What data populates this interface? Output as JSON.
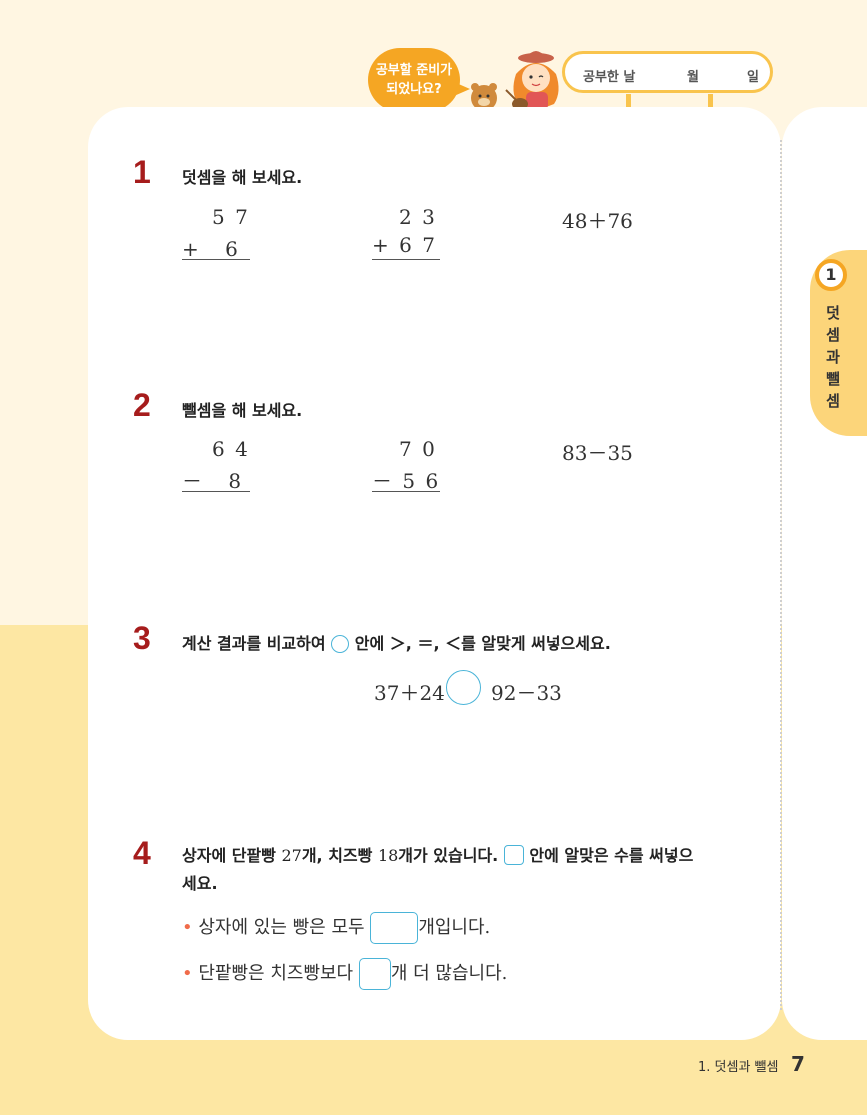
{
  "header": {
    "speech_line1": "공부할 준비가",
    "speech_line2": "되었나요?",
    "date_label": "공부한 날",
    "month_label": "월",
    "day_label": "일"
  },
  "side_tab": {
    "number": "1",
    "title_chars": [
      "덧",
      "셈",
      "과",
      "뺄",
      "셈"
    ]
  },
  "q1": {
    "number": "1",
    "instruction": "덧셈을 해 보세요.",
    "p1_top": "5 7",
    "p1_bottom": "+ 　6",
    "p2_top": "2 3",
    "p2_bottom": "+ 6 7",
    "p3": "48＋76"
  },
  "q2": {
    "number": "2",
    "instruction": "뺄셈을 해 보세요.",
    "p1_top": "6 4",
    "p1_bottom": "－ 　8",
    "p2_top": "7 0",
    "p2_bottom": "－ 5 6",
    "p3": "83－35"
  },
  "q3": {
    "number": "3",
    "instruction_pre": "계산 결과를 비교하여",
    "instruction_post": "안에 ＞, ＝, ＜를 알맞게 써넣으세요.",
    "left_expr": "37＋24",
    "right_expr": "92－33"
  },
  "q4": {
    "number": "4",
    "line1_a": "상자에 단팥빵 ",
    "line1_b": "27",
    "line1_c": "개, 치즈빵 ",
    "line1_d": "18",
    "line1_e": "개가 있습니다.",
    "line1_f": "안에 알맞은 수를 써넣으",
    "line2": "세요.",
    "bullet1_pre": "상자에 있는 빵은 모두",
    "bullet1_post": "개입니다.",
    "bullet2_pre": "단팥빵은 치즈빵보다",
    "bullet2_post": "개 더 많습니다."
  },
  "footer": {
    "chapter": "1. 덧셈과 뺄셈",
    "page": "7"
  }
}
